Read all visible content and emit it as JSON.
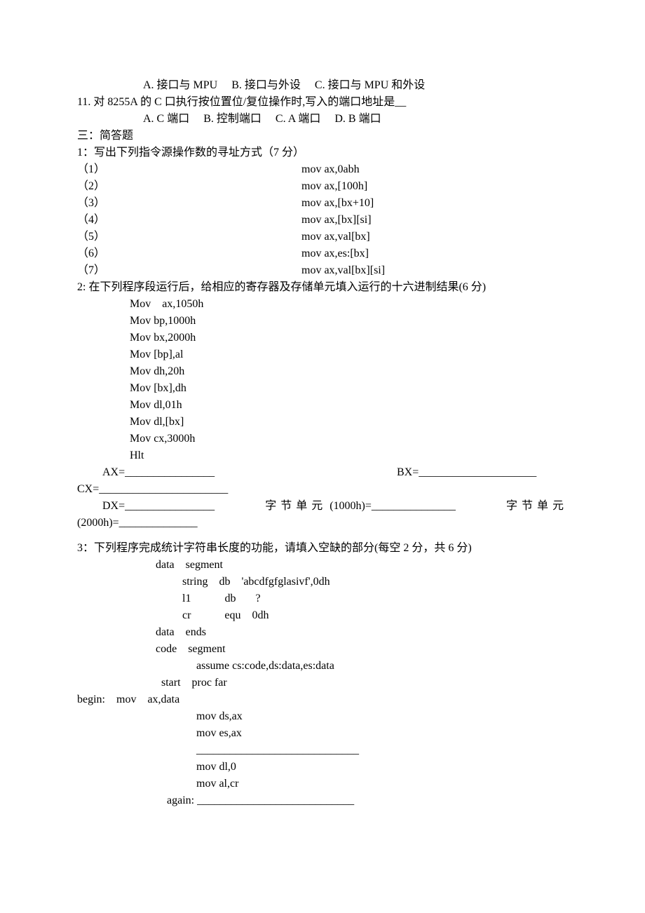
{
  "q10_options": "        A. 接口与 MPU     B. 接口与外设     C. 接口与 MPU 和外设",
  "q11": "11. 对 8255A 的 C 口执行按位置位/复位操作时,写入的端口地址是__",
  "q11_options": "        A. C 端口     B. 控制端口     C. A 端口     D. B 端口",
  "section3": "三：简答题",
  "q3_1": "1：写出下列指令源操作数的寻址方式（7 分）",
  "q3_1_rows": {
    "r1l": "（1）",
    "r1r": "mov ax,0abh",
    "r2l": "（2）",
    "r2r": "mov ax,[100h]",
    "r3l": "（3）",
    "r3r": "mov ax,[bx+10]",
    "r4l": "（4）",
    "r4r": "mov ax,[bx][si]",
    "r5l": "（5）",
    "r5r": "mov ax,val[bx]",
    "r6l": "（6）",
    "r6r": "mov ax,es:[bx]",
    "r7l": "（7）",
    "r7r": "mov ax,val[bx][si]"
  },
  "q3_2": "2: 在下列程序段运行后，给相应的寄存器及存储单元填入运行的十六进制结果(6 分)",
  "q3_2_code": {
    "l1": "Mov    ax,1050h",
    "l2": "Mov bp,1000h",
    "l3": "Mov bx,2000h",
    "l4": "Mov [bp],al",
    "l5": "Mov dh,20h",
    "l6": "Mov [bx],dh",
    "l7": "Mov dl,01h",
    "l8": "Mov dl,[bx]",
    "l9": "Mov cx,3000h",
    "l10": "Hlt"
  },
  "q3_2_ans": {
    "ax": "AX=________________",
    "bx": "BX=_____________________",
    "cx": "CX=_______________________",
    "dx_pre": "DX=",
    "dx_suf": "________________",
    "b1_pre": "字节单元",
    "b1_suf": "(1000h)=_______________",
    "b2_pre": "字节单元",
    "b2_suf": "(2000h)=______________"
  },
  "q3_3": "3：下列程序完成统计字符串长度的功能，请填入空缺的部分(每空 2 分，共 6 分)",
  "q3_3_code": {
    "l1": "data    segment",
    "l2": "string    db    'abcdfgfglasivf',0dh",
    "l3": "l1            db       ?",
    "l4": "cr            equ    0dh",
    "l5": "data    ends",
    "l6": "code    segment",
    "l7": "assume cs:code,ds:data,es:data",
    "l8": "start    proc far",
    "l9": "begin:    mov    ax,data",
    "l10": "mov ds,ax",
    "l11": "mov es,ax",
    "l12": "_____________________________",
    "l13": "mov dl,0",
    "l14": "mov al,cr",
    "l15": "again: ____________________________"
  }
}
